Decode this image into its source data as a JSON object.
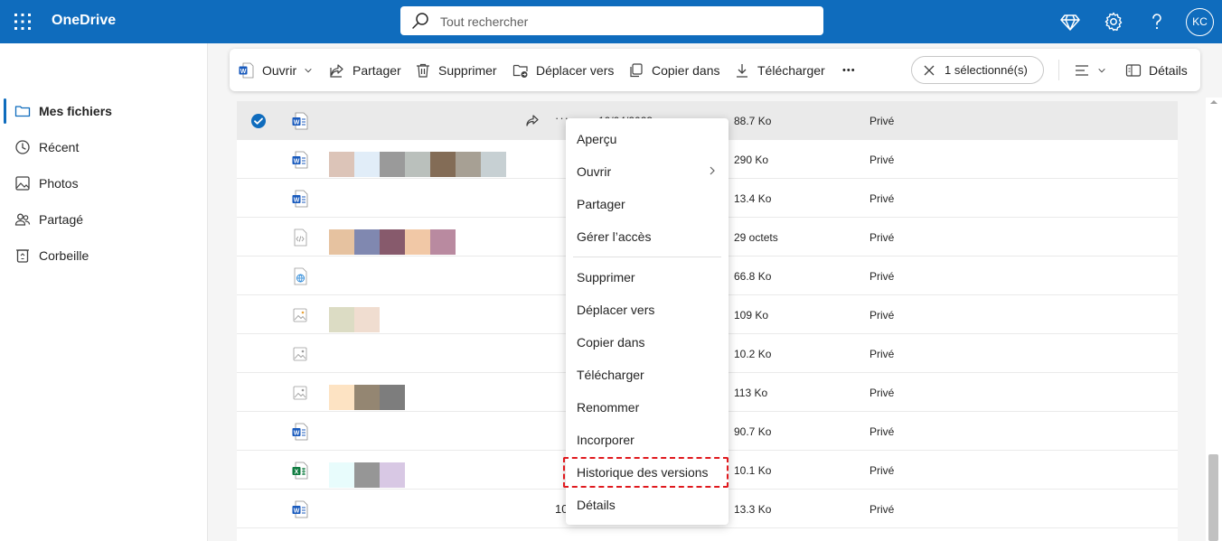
{
  "app": {
    "name": "OneDrive"
  },
  "search": {
    "placeholder": "Tout rechercher"
  },
  "account": {
    "initials": "KC"
  },
  "nav": {
    "items": [
      {
        "label": "Mes fichiers",
        "icon": "folder-icon"
      },
      {
        "label": "Récent",
        "icon": "clock-icon"
      },
      {
        "label": "Photos",
        "icon": "photo-icon"
      },
      {
        "label": "Partagé",
        "icon": "people-icon"
      },
      {
        "label": "Corbeille",
        "icon": "recycle-bin-icon"
      }
    ]
  },
  "toolbar": {
    "open": "Ouvrir",
    "share": "Partager",
    "delete": "Supprimer",
    "move": "Déplacer vers",
    "copy": "Copier dans",
    "download": "Télécharger",
    "more": "•••",
    "selection": "1 sélectionné(s)",
    "details": "Détails"
  },
  "files": [
    {
      "type": "word",
      "size": "88.7 Ko",
      "sharing": "Privé",
      "selected": true,
      "partial": "10/04/2023"
    },
    {
      "type": "word",
      "size": "290 Ko",
      "sharing": "Privé"
    },
    {
      "type": "word",
      "size": "13.4 Ko",
      "sharing": "Privé"
    },
    {
      "type": "code",
      "size": "29 octets",
      "sharing": "Privé"
    },
    {
      "type": "web",
      "size": "66.8 Ko",
      "sharing": "Privé"
    },
    {
      "type": "image",
      "size": "109 Ko",
      "sharing": "Privé"
    },
    {
      "type": "image",
      "size": "10.2 Ko",
      "sharing": "Privé"
    },
    {
      "type": "image",
      "size": "113 Ko",
      "sharing": "Privé"
    },
    {
      "type": "word",
      "size": "90.7 Ko",
      "sharing": "Privé"
    },
    {
      "type": "excel",
      "size": "10.1 Ko",
      "sharing": "Privé"
    },
    {
      "type": "word",
      "size": "13.3 Ko",
      "sharing": "Privé",
      "partial": "10"
    }
  ],
  "context_menu": {
    "items": [
      "Aperçu",
      "Ouvrir",
      "Partager",
      "Gérer l’accès",
      "Supprimer",
      "Déplacer vers",
      "Copier dans",
      "Télécharger",
      "Renommer",
      "Incorporer",
      "Historique des versions",
      "Détails"
    ],
    "highlighted": "Historique des versions"
  },
  "colors": {
    "brand": "#0f6cbd",
    "word": "#185abd",
    "excel": "#107c41",
    "highlight_border": "#e0191e"
  }
}
